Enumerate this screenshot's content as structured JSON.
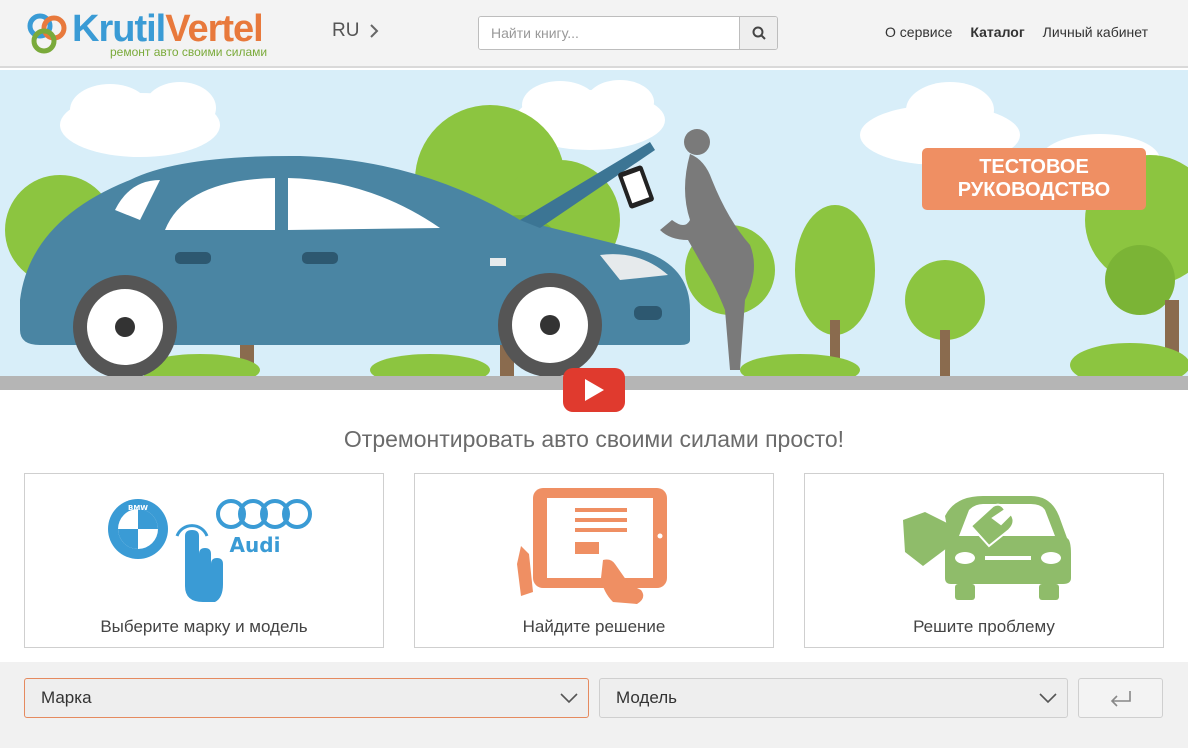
{
  "header": {
    "logo": {
      "brand_first": "Krutil",
      "brand_second": "Vertel",
      "tagline": "ремонт авто своими силами"
    },
    "lang": {
      "label": "RU",
      "icon": "chevron-right-icon"
    },
    "search": {
      "placeholder": "Найти книгу...",
      "icon": "search-icon"
    },
    "nav": [
      {
        "label": "О сервисе",
        "active": false
      },
      {
        "label": "Каталог",
        "active": true
      },
      {
        "label": "Личный кабинет",
        "active": false
      }
    ]
  },
  "hero": {
    "badge_line1": "ТЕСТОВОЕ",
    "badge_line2": "РУКОВОДСТВО",
    "play_icon": "youtube-play-icon"
  },
  "tagline": "Отремонтировать авто своими силами просто!",
  "cards": [
    {
      "label": "Выберите марку и модель",
      "icon": "brand-logos-hand-icon",
      "logo_text": "Audi",
      "logo_text_2": "BMW"
    },
    {
      "label": "Найдите решение",
      "icon": "tablet-hands-icon"
    },
    {
      "label": "Решите проблему",
      "icon": "car-wrench-icon"
    }
  ],
  "selectors": {
    "make": {
      "value": "Марка",
      "icon": "chevron-down-icon"
    },
    "model": {
      "value": "Модель",
      "icon": "chevron-down-icon"
    },
    "submit_icon": "enter-arrow-icon"
  },
  "colors": {
    "brand_blue": "#3a9bd5",
    "brand_orange": "#e8793c",
    "brand_green": "#7aaa3a",
    "badge": "#ef8f63",
    "play_red": "#e03a2e",
    "car_blue": "#4a85a3"
  }
}
